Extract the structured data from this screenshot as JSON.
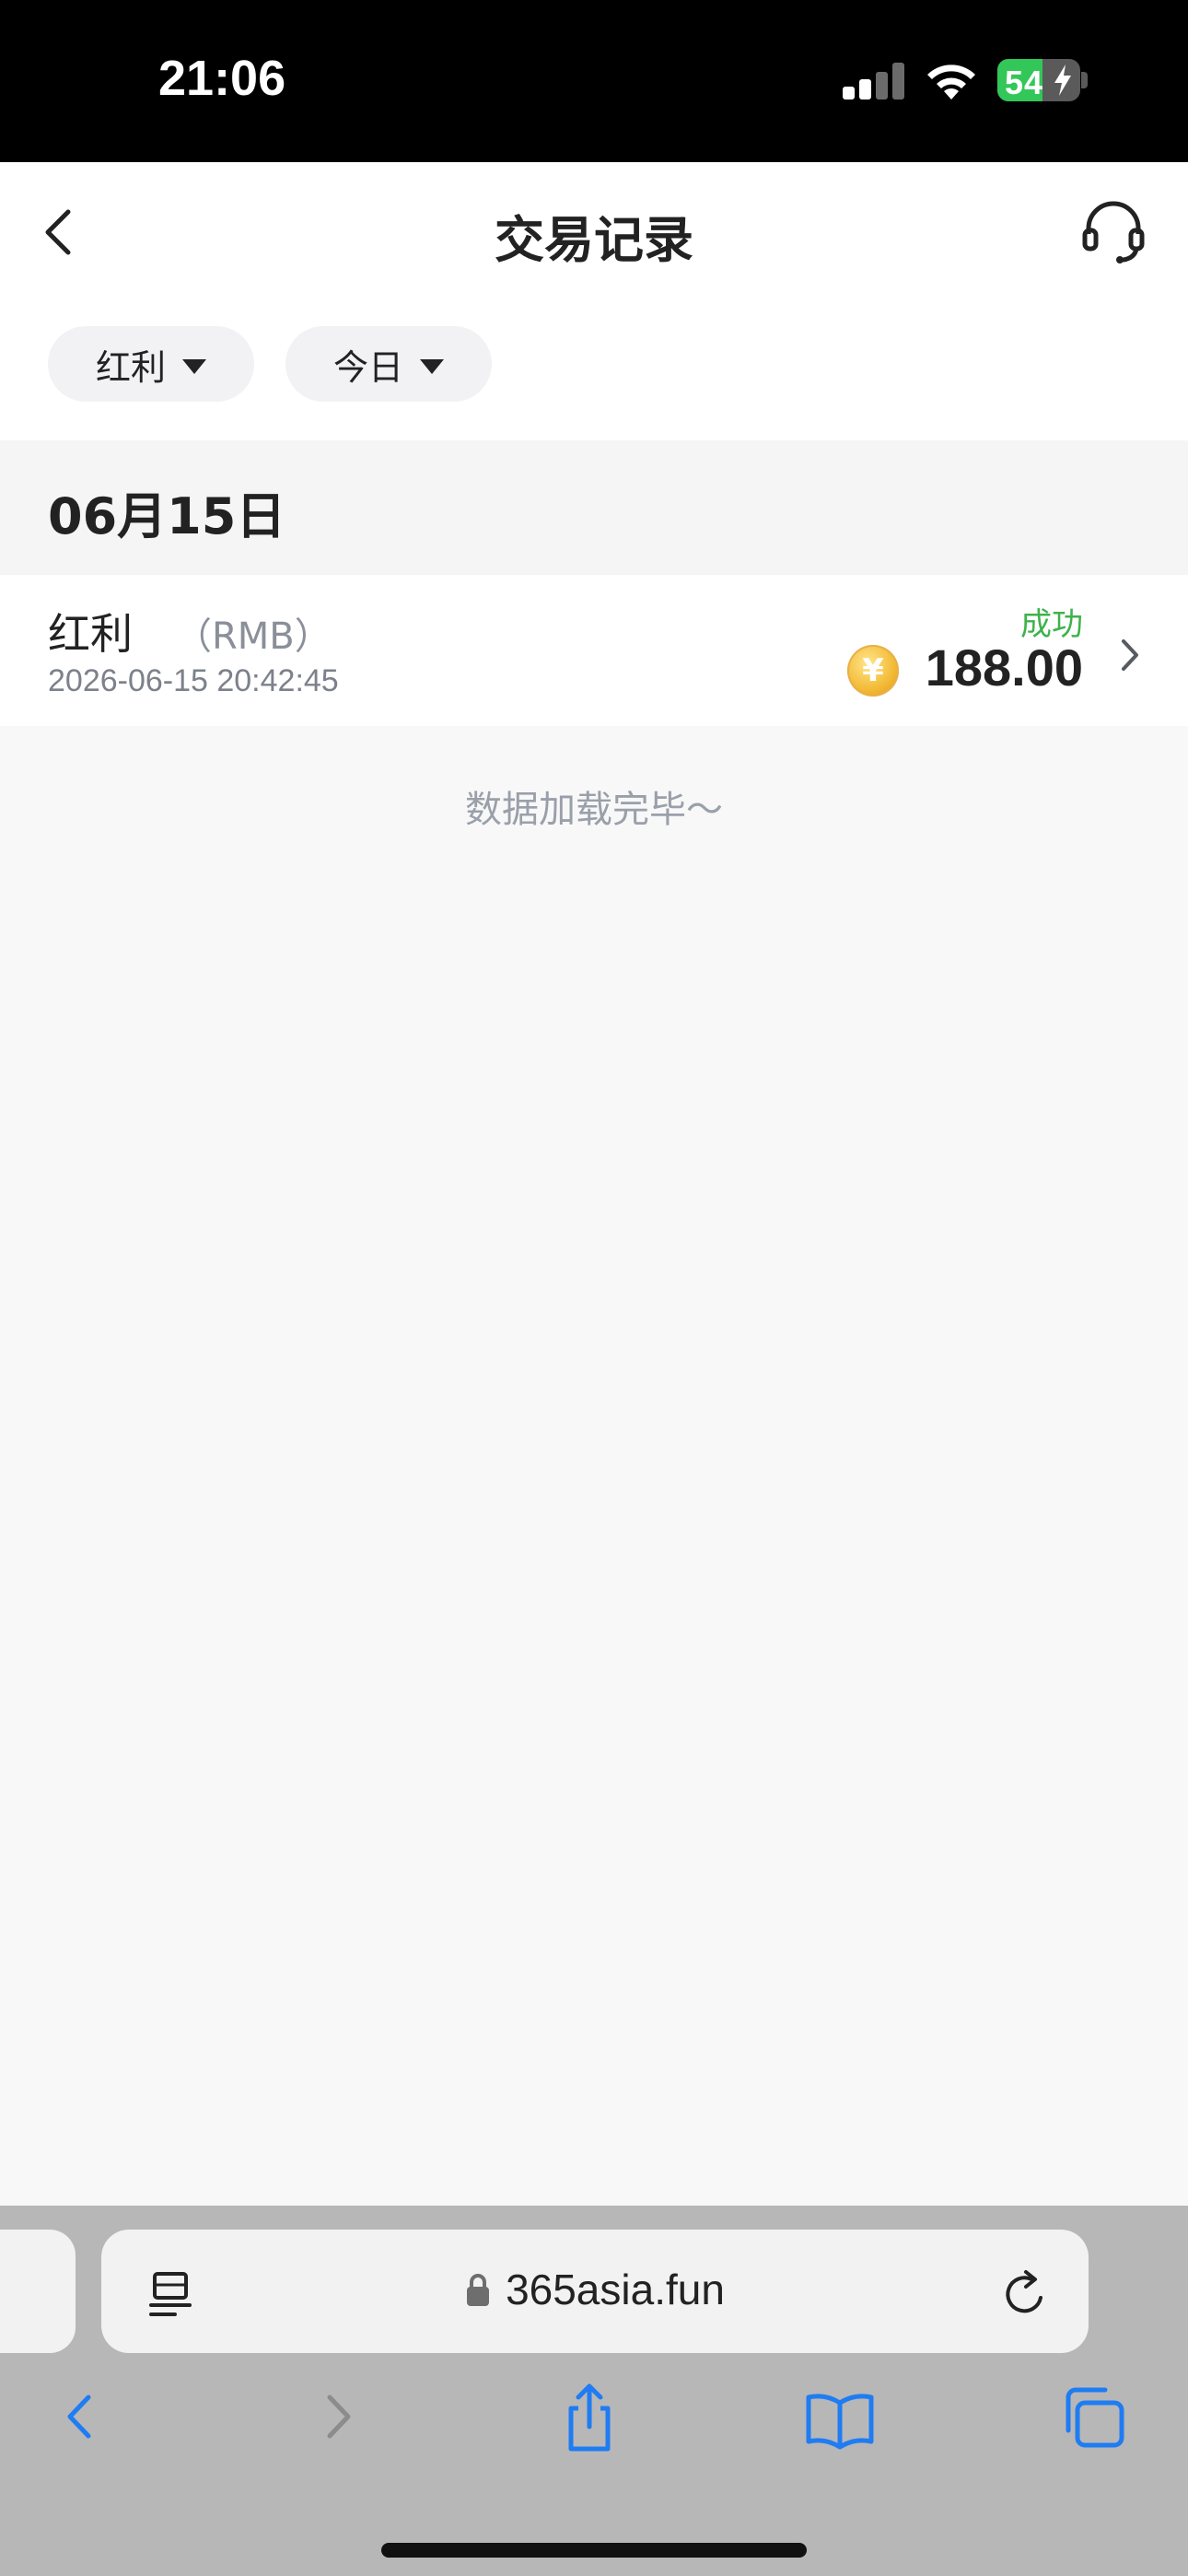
{
  "status_bar": {
    "time": "21:06",
    "battery_percent": "54",
    "battery_level": 0.54,
    "signal_icon": "cellular-signal-icon",
    "wifi_icon": "wifi-icon",
    "charging_icon": "bolt-icon"
  },
  "nav": {
    "title": "交易记录",
    "back_icon": "chevron-left-icon",
    "service_icon": "headset-icon"
  },
  "filters": [
    {
      "label": "红利",
      "icon": "caret-down-icon"
    },
    {
      "label": "今日",
      "icon": "caret-down-icon"
    }
  ],
  "date_group": "06月15日",
  "transactions": [
    {
      "type": "红利",
      "currency": "（RMB）",
      "time": "2026-06-15 20:42:45",
      "status": "成功",
      "amount": "188.00",
      "coin_symbol": "¥"
    }
  ],
  "load_complete_text": "数据加载完毕～",
  "browser": {
    "url": "365asia.fun",
    "toolbar": [
      "back-icon",
      "forward-icon",
      "share-icon",
      "bookmarks-icon",
      "tabs-icon"
    ]
  },
  "colors": {
    "success": "#3fb24b",
    "accent": "#1f7cf2",
    "battery": "#33c759"
  }
}
